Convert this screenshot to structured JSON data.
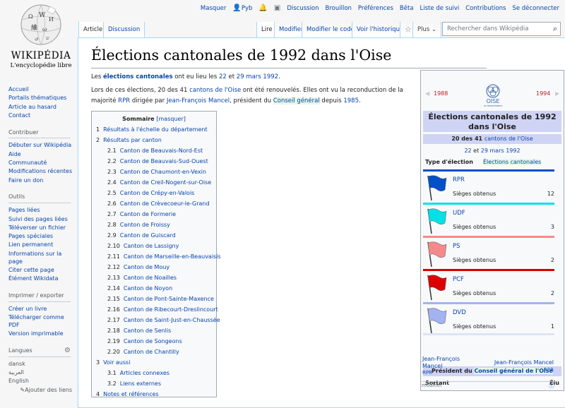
{
  "personal": [
    "Masquer",
    "Pyb",
    "Discussion",
    "Brouillon",
    "Préférences",
    "Bêta",
    "Liste de suivi",
    "Contributions",
    "Se déconnecter"
  ],
  "logo": {
    "wordmark": "WIKIPÉDIA",
    "tagline": "L'encyclopédie libre"
  },
  "sidebar": {
    "main": [
      "Accueil",
      "Portails thématiques",
      "Article au hasard",
      "Contact"
    ],
    "contribuer": {
      "title": "Contribuer",
      "items": [
        "Débuter sur Wikipédia",
        "Aide",
        "Communauté",
        "Modifications récentes",
        "Faire un don"
      ]
    },
    "outils": {
      "title": "Outils",
      "items": [
        "Pages liées",
        "Suivi des pages liées",
        "Téléverser un fichier",
        "Pages spéciales",
        "Lien permanent",
        "Informations sur la page",
        "Citer cette page",
        "Élément Wikidata"
      ]
    },
    "imprimer": {
      "title": "Imprimer / exporter",
      "items": [
        "Créer un livre",
        "Télécharger comme PDF",
        "Version imprimable"
      ]
    },
    "langues": {
      "title": "Langues",
      "items": [
        "dansk",
        "العربية",
        "English"
      ],
      "edit": "Ajouter des liens"
    }
  },
  "tabs": {
    "article": "Article",
    "discussion": "Discussion",
    "lire": "Lire",
    "modifier": "Modifier",
    "modifier_code": "Modifier le code",
    "historique": "Voir l'historique",
    "plus": "Plus"
  },
  "search": {
    "placeholder": "Rechercher dans Wikipédia"
  },
  "page": {
    "title": "Élections cantonales de 1992 dans l'Oise",
    "p1": [
      "Les ",
      "élections cantonales",
      " ont eu lieu les ",
      "22",
      " et ",
      "29 mars 1992",
      "."
    ],
    "p2a": [
      "Lors de ces élections, 20 des 41 ",
      "cantons de l'Oise",
      " ont été renouvelés. Elles ont vu la reconduction de la"
    ],
    "p2b": [
      "majorité ",
      "RPR",
      " dirigée par ",
      "Jean-François Mancel",
      ", président du ",
      "Conseil général",
      " depuis ",
      "1985",
      "."
    ]
  },
  "toc": {
    "title": "Sommaire",
    "toggle": "[masquer]",
    "items": [
      [
        "1",
        "Résultats à l'échelle du département",
        1
      ],
      [
        "2",
        "Résultats par canton",
        1
      ],
      [
        "2.1",
        "Canton de Beauvais-Nord-Est",
        2
      ],
      [
        "2.2",
        "Canton de Beauvais-Sud-Ouest",
        2
      ],
      [
        "2.3",
        "Canton de Chaumont-en-Vexin",
        2
      ],
      [
        "2.4",
        "Canton de Creil-Nogent-sur-Oise",
        2
      ],
      [
        "2.5",
        "Canton de Crépy-en-Valois",
        2
      ],
      [
        "2.6",
        "Canton de Crèvecoeur-le-Grand",
        2
      ],
      [
        "2.7",
        "Canton de Formerie",
        2
      ],
      [
        "2.8",
        "Canton de Froissy",
        2
      ],
      [
        "2.9",
        "Canton de Guiscard",
        2
      ],
      [
        "2.10",
        "Canton de Lassigny",
        2
      ],
      [
        "2.11",
        "Canton de Marseille-en-Beauvaisis",
        2
      ],
      [
        "2.12",
        "Canton de Mouy",
        2
      ],
      [
        "2.13",
        "Canton de Noailles",
        2
      ],
      [
        "2.14",
        "Canton de Noyon",
        2
      ],
      [
        "2.15",
        "Canton de Pont-Sainte-Maxence",
        2
      ],
      [
        "2.16",
        "Canton de Ribecourt-Dreslincourt",
        2
      ],
      [
        "2.17",
        "Canton de Saint-Just-en-Chaussée",
        2
      ],
      [
        "2.18",
        "Canton de Senlis",
        2
      ],
      [
        "2.19",
        "Canton de Songeons",
        2
      ],
      [
        "2.20",
        "Canton de Chantilly",
        2
      ],
      [
        "3",
        "Voir aussi",
        1
      ],
      [
        "3.1",
        "Articles connexes",
        2
      ],
      [
        "3.2",
        "Liens externes",
        2
      ],
      [
        "4",
        "Notes et références",
        1
      ]
    ]
  },
  "infobox": {
    "prev": "1988",
    "next": "1994",
    "logo_text": "OISE",
    "logo_sub": "LE DÉPARTEMENT",
    "title": "Élections cantonales de 1992 dans l'Oise",
    "cantons_a": "20 des 41 ",
    "cantons_b": "cantons de l'Oise",
    "date_a": "22",
    " date_b": "",
    "dates": [
      "22",
      "et",
      "29 mars 1992"
    ],
    "type_label": "Type d'élection",
    "type_value": "Élections cantonales",
    "seats_label": "Sièges obtenus",
    "parties": [
      {
        "name": "RPR",
        "seats": "12",
        "color": "#0050c8"
      },
      {
        "name": "UDF",
        "seats": "3",
        "color": "#00e1e6"
      },
      {
        "name": "PS",
        "seats": "2",
        "color": "#f48a8a"
      },
      {
        "name": "PCF",
        "seats": "2",
        "color": "#dd0000"
      },
      {
        "name": "DVD",
        "seats": "1",
        "color": "#a3b3f0"
      }
    ],
    "president_a": "Président du ",
    "president_b": "Conseil général de l'Oise",
    "sortant": "Sortant",
    "elu": "Élu",
    "sortant_name": [
      "Jean-François",
      "Mancel"
    ],
    "sortant_party": "RPR",
    "elu_name": "Jean-François Mancel",
    "elu_party": "RPR",
    "modifier": "modifier"
  }
}
